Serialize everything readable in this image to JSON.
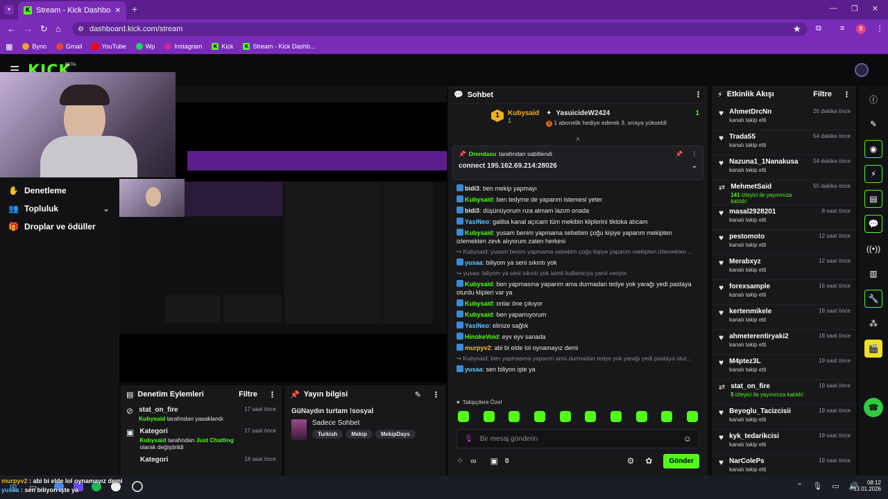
{
  "browser": {
    "tab_title": "Stream - Kick Dashboard",
    "url": "dashboard.kick.com/stream",
    "bookmarks": [
      "Byno",
      "Gmail",
      "YouTube",
      "Wp",
      "Instagram",
      "Kick",
      "Stream - Kick Dashb..."
    ],
    "profile_initial": "B"
  },
  "kick": {
    "logo": "KICK",
    "beta": "BETA"
  },
  "sidebar": {
    "items": [
      "Denetleme",
      "Topluluk",
      "Droplar ve ödüller"
    ]
  },
  "moderation": {
    "title": "Denetim Eylemleri",
    "filter": "Filtre",
    "items": [
      {
        "title": "stat_on_fire",
        "actor": "Kubysaid",
        "action": " tarafından yasaklandı",
        "time": "17 saat önce"
      },
      {
        "title": "Kategori",
        "actor": "Kubysaid",
        "action": " tarafından ",
        "cat": "Just Chatting",
        "action2": " olarak değiştirildi",
        "time": "17 saat önce"
      },
      {
        "title": "Kategori",
        "time": "18 saat önce"
      }
    ]
  },
  "streaminfo": {
    "title": "Yayın bilgisi",
    "stream_title": "GüNaydın turtam !sosyal",
    "category": "Sadece Sohbet",
    "tags": [
      "Turkish",
      "Mekip",
      "MekipDays"
    ]
  },
  "chat": {
    "title": "Sohbet",
    "top1_name": "Kubysaid",
    "top1_rank": "1",
    "top1_count": "1",
    "top2_name": "YasuicideW2424",
    "top2_count": "1",
    "top2_note": "1 abonelik hediye ederek 3. sıraya yükseldi",
    "top2_rank": "3",
    "pinned_by": "Orendasu",
    "pinned_suffix": " tarafından sabitlendi",
    "pinned_text": "connect 195.162.69.214:28026",
    "messages": [
      {
        "user": "bidi3",
        "text": ": ben mekip yapmayı",
        "color": "#e8e8e8"
      },
      {
        "user": "Kubysaid",
        "text": ": ben tedyme de yaparım istemesi yeter",
        "color": "#53fc18"
      },
      {
        "user": "bidi3",
        "text": ": düşünüyorum rıza almam lazım onada",
        "color": "#e8e8e8"
      },
      {
        "user": "YasiNeo",
        "text": ": galiba kanal açıcam tüm mekibin kliplerini tiktoka atıcam",
        "color": "#5fc8ff"
      },
      {
        "user": "Kubysaid",
        "text": ": yusam benim yapmama sebebim çoğu kişiye yaparım mekipten izlemekten zevk alıyorum zaten herkesi",
        "color": "#53fc18"
      },
      {
        "reply": "Kubysaid: yusam benim yapmama sebebim çoğu kişiye yaparım mekipten izlemekten ..."
      },
      {
        "user": "yusaa",
        "text": ": biliyom ya seni sıkıntı yok",
        "color": "#5fc8ff"
      },
      {
        "reply": "yusaa: biliyom ya seni sıkıntı yok isimli kullanıcıya yanıt veriyor"
      },
      {
        "user": "Kubysaid",
        "text": ": ben yapmasına yaparım ama durmadan tedye yok yarağı yedi pastaya oturdu klipleri var ya",
        "color": "#53fc18"
      },
      {
        "user": "Kubysaid",
        "text": ": onlar öne çıkıyor",
        "color": "#53fc18"
      },
      {
        "user": "Kubysaid",
        "text": ": ben yapamıyorum",
        "color": "#53fc18"
      },
      {
        "user": "YasiNeo",
        "text": ": elinize sağlık",
        "color": "#5fc8ff"
      },
      {
        "user": "HinokeVoid",
        "text": ": eyv eyv sanada",
        "color": "#53fc18"
      },
      {
        "user": "murpyv2",
        "text": ": abi bi elde lol oynamayız demi",
        "color": "#f0c020"
      },
      {
        "reply": "Kubysaid: ben yapmasına yaparım ama durmadan tedye yok yarağı yedi pastaya otur..."
      },
      {
        "user": "yusaa",
        "text": ": sen biliyon işte ya",
        "color": "#5fc8ff"
      }
    ],
    "follower_only": "Takipçilere Özel",
    "placeholder": "Bir mesaj gönderin",
    "points": "0",
    "send": "Gönder"
  },
  "activity": {
    "title": "Etkinlik Akışı",
    "filter": "Filtre",
    "items": [
      {
        "name": "AhmetDrcNn",
        "sub": "kanalı takip etti",
        "time": "26 dakika önce",
        "type": "follow"
      },
      {
        "name": "Trada55",
        "sub": "kanalı takip etti",
        "time": "54 dakika önce",
        "type": "follow"
      },
      {
        "name": "Nazuna1_1Nanakusa",
        "sub": "kanalı takip etti",
        "time": "54 dakika önce",
        "type": "follow"
      },
      {
        "name": "MehmetSaid",
        "count": "141",
        "sub": " izleyici ile yayınınıza katıldı!",
        "time": "55 dakika önce",
        "type": "raid"
      },
      {
        "name": "masal2928201",
        "sub": "kanalı takip etti",
        "time": "8 saat önce",
        "type": "follow"
      },
      {
        "name": "pestomoto",
        "sub": "kanalı takip etti",
        "time": "12 saat önce",
        "type": "follow"
      },
      {
        "name": "Merabxyz",
        "sub": "kanalı takip etti",
        "time": "12 saat önce",
        "type": "follow"
      },
      {
        "name": "forexsample",
        "sub": "kanalı takip etti",
        "time": "16 saat önce",
        "type": "follow"
      },
      {
        "name": "kertenmikele",
        "sub": "kanalı takip etti",
        "time": "18 saat önce",
        "type": "follow"
      },
      {
        "name": "ahmeterentiryaki2",
        "sub": "kanalı takip etti",
        "time": "18 saat önce",
        "type": "follow"
      },
      {
        "name": "M4ptez3L",
        "sub": "kanalı takip etti",
        "time": "19 saat önce",
        "type": "follow"
      },
      {
        "name": "stat_on_fire",
        "count": "5",
        "sub": " izleyici ile yayınınıza katıldı!",
        "time": "19 saat önce",
        "type": "raid"
      },
      {
        "name": "Beyoglu_Tacizcisii",
        "sub": "kanalı takip etti",
        "time": "19 saat önce",
        "type": "follow"
      },
      {
        "name": "kyk_tedarikcisi",
        "sub": "kanalı takip etti",
        "time": "19 saat önce",
        "type": "follow"
      },
      {
        "name": "NarColePs",
        "sub": "kanalı takip etti",
        "time": "19 saat önce",
        "type": "follow"
      }
    ]
  },
  "overlay": [
    {
      "user": "murpyv2",
      "text": " : abi bi elde lol oynamayız demi"
    },
    {
      "user": "yusaa",
      "text": " : sen biliyon işte ya"
    }
  ],
  "taskbar": {
    "time": "08:12",
    "date": "13.01.2026"
  },
  "colors": {
    "kick_green": "#53fc18",
    "browser_purple": "#7a2cb8"
  }
}
